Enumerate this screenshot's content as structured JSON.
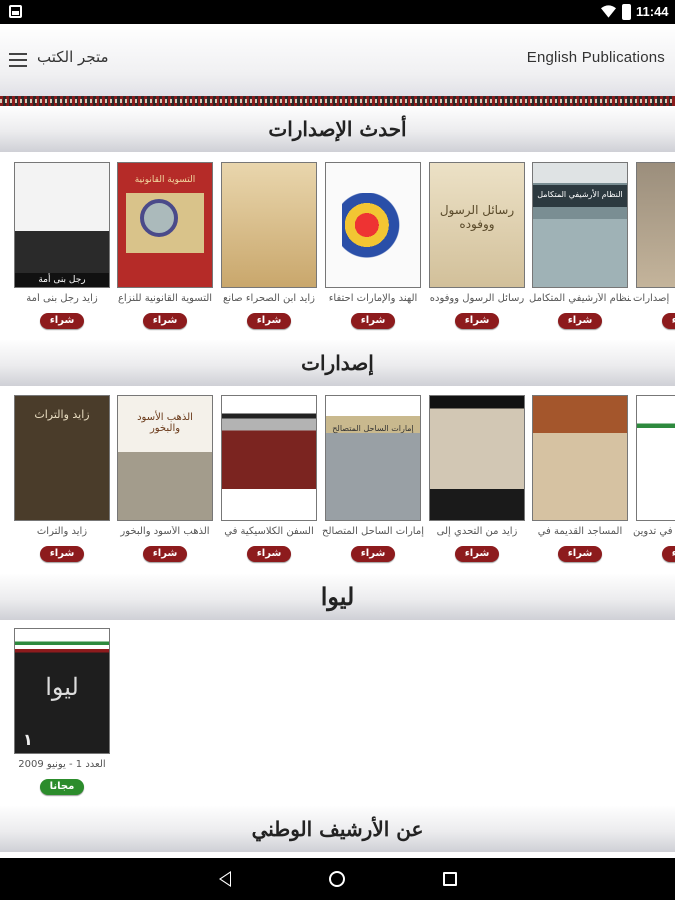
{
  "status_bar": {
    "time": "11:44",
    "icons": [
      "notification-icon",
      "wifi-icon",
      "battery-icon"
    ]
  },
  "header": {
    "english_link": "English Publications",
    "store_title": "متجر الكتب",
    "menu_icon": "hamburger-icon"
  },
  "sections": [
    {
      "title": "أحدث الإصدارات",
      "books": [
        {
          "title": "زايد رجل بنى أمة",
          "button": "شراء",
          "cover_text": "زايد",
          "cover_caption": "رجل بنى أمة"
        },
        {
          "title": "التسوية القانونية للنزاع",
          "button": "شراء",
          "cover_text": "التسوية القانونية"
        },
        {
          "title": "زايد ابن الصحراء صانع",
          "button": "شراء",
          "cover_text": ""
        },
        {
          "title": "الهند والإمارات احتفاء",
          "button": "شراء",
          "cover_text": ""
        },
        {
          "title": "رسائل الرسول ووفوده",
          "button": "شراء",
          "cover_text": "رسائل الرسول ووفوده"
        },
        {
          "title": "النظام الأرشيفي المتكامل",
          "button": "شراء",
          "cover_text": "النظام الأرشيفي المتكامل"
        },
        {
          "title": "إصدارات",
          "button": "شراء",
          "cover_text": ""
        }
      ]
    },
    {
      "title": "إصدارات",
      "books": [
        {
          "title": "زايد والتراث",
          "button": "شراء",
          "cover_text": "زايد والتراث"
        },
        {
          "title": "الذهب الأسود والبخور",
          "button": "شراء",
          "cover_text": "الذهب الأسود والبخور"
        },
        {
          "title": "السفن الكلاسيكية في",
          "button": "شراء",
          "cover_text": ""
        },
        {
          "title": "إمارات الساحل المتصالح",
          "button": "شراء",
          "cover_text": "إمارات الساحل المتصالح"
        },
        {
          "title": "زايد من التحدي إلى",
          "button": "شراء",
          "cover_text": ""
        },
        {
          "title": "المساجد القديمة في",
          "button": "شراء",
          "cover_text": ""
        },
        {
          "title": "في تدوين",
          "button": "شراء",
          "cover_text": ""
        }
      ]
    },
    {
      "title": "ليوا",
      "books": [
        {
          "title": "العدد 1 - يونيو 2009",
          "button": "مجانا",
          "cover_text": "ليوا",
          "cover_number": "١"
        }
      ]
    },
    {
      "title": "عن الأرشيف الوطني",
      "books": []
    }
  ],
  "nav": {
    "icons": [
      "back-icon",
      "home-icon",
      "recents-icon"
    ]
  },
  "colors": {
    "buy_button": "#8d1b1d",
    "free_button": "#2c8c2c"
  }
}
